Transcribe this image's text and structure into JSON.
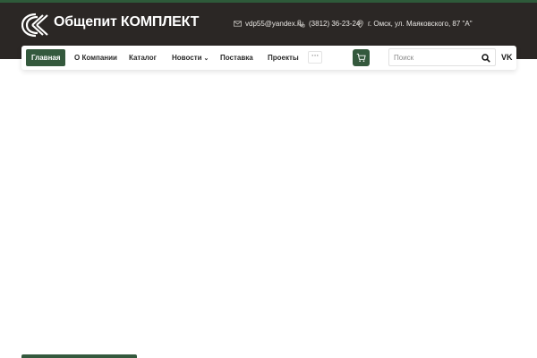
{
  "header": {
    "logo_text": "Общепит КОМПЛЕКТ",
    "email": "vdp55@yandex.ru",
    "phone": "(3812) 36-23-24",
    "address": "г. Омск, ул. Маяковского, 87 \"А\""
  },
  "nav": {
    "items": [
      {
        "label": "Главная",
        "active": true
      },
      {
        "label": "О Компании"
      },
      {
        "label": "Каталог"
      },
      {
        "label": "Новости",
        "has_dropdown": true
      },
      {
        "label": "Поставка"
      },
      {
        "label": "Проекты"
      }
    ],
    "more_label": "···",
    "cart_icon": "cart-icon",
    "search_placeholder": "Поиск",
    "social_label": "VK"
  },
  "colors": {
    "header_bg": "#2b2725",
    "accent_green": "#34593d",
    "text_light": "#e8e6e3"
  }
}
